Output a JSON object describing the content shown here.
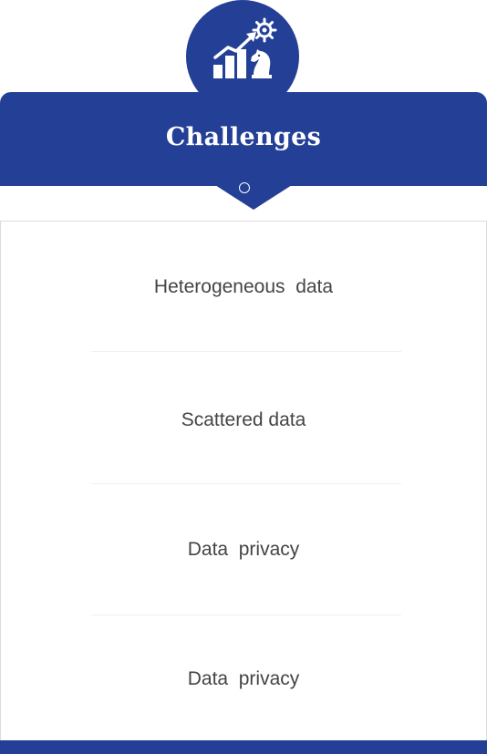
{
  "header": {
    "icon": "growth-chart-chess-knight-icon",
    "title": "Challenges"
  },
  "items": [
    {
      "label": "Heterogeneous  data"
    },
    {
      "label": "Scattered data"
    },
    {
      "label": "Data  privacy"
    },
    {
      "label": "Data  privacy"
    }
  ],
  "colors": {
    "primary": "#233f96",
    "text": "#444444",
    "background": "#ffffff",
    "divider": "#f0f0f0"
  }
}
